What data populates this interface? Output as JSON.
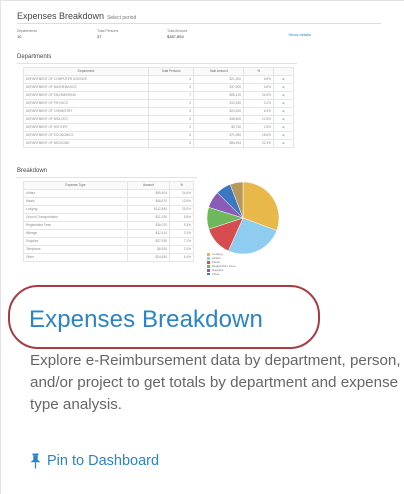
{
  "thumbnail": {
    "title": "Expenses Breakdown",
    "subtitle": "Select period",
    "stats": [
      {
        "label": "Departments",
        "value": "10"
      },
      {
        "label": "Total Persons",
        "value": "37"
      },
      {
        "label": "Total Amount",
        "value": "$387,854"
      }
    ],
    "link": "Show details",
    "departments_section": "Departments",
    "departments_table": {
      "headers": [
        "Department",
        "Total Persons",
        "Total Amount",
        "%",
        ""
      ],
      "rows": [
        [
          "DEPARTMENT OF COMPUTER SCIENCE",
          "4",
          "$21,300",
          "5.5%",
          "⊕"
        ],
        [
          "DEPARTMENT OF MATHEMATICS",
          "3",
          "$17,900",
          "4.6%",
          "⊕"
        ],
        [
          "DEPARTMENT OF ENGINEERING",
          "7",
          "$95,120",
          "24.5%",
          "⊕"
        ],
        [
          "DEPARTMENT OF PHYSICS",
          "2",
          "$12,480",
          "3.2%",
          "⊕"
        ],
        [
          "DEPARTMENT OF CHEMISTRY",
          "3",
          "$24,300",
          "6.3%",
          "⊕"
        ],
        [
          "DEPARTMENT OF BIOLOGY",
          "5",
          "$48,600",
          "12.5%",
          "⊕"
        ],
        [
          "DEPARTMENT OF HISTORY",
          "2",
          "$9,750",
          "2.5%",
          "⊕"
        ],
        [
          "DEPARTMENT OF ECONOMICS",
          "6",
          "$71,950",
          "18.6%",
          "⊕"
        ],
        [
          "DEPARTMENT OF MEDICINE",
          "5",
          "$86,454",
          "22.3%",
          "⊕"
        ]
      ]
    },
    "breakdown_section": "Breakdown",
    "breakdown_table": {
      "headers": [
        "Expense Type",
        "Amount",
        "%"
      ],
      "rows": [
        [
          "Airfare",
          "$95,404",
          "24.6%"
        ],
        [
          "Meals",
          "$48,870",
          "12.6%"
        ],
        [
          "Lodging",
          "$112,480",
          "29.0%"
        ],
        [
          "Ground Transportation",
          "$21,330",
          "5.5%"
        ],
        [
          "Registration Fees",
          "$36,070",
          "9.3%"
        ],
        [
          "Mileage",
          "$12,410",
          "3.2%"
        ],
        [
          "Supplies",
          "$27,930",
          "7.2%"
        ],
        [
          "Telephone",
          "$8,530",
          "2.2%"
        ],
        [
          "Other",
          "$24,830",
          "6.4%"
        ]
      ]
    },
    "pie_colors": [
      "#e9b84a",
      "#8ecdf0",
      "#d64c4f",
      "#6db85a",
      "#8a5bb6",
      "#3b78c2",
      "#b5985a"
    ],
    "legend": [
      "Lodging",
      "Airfare",
      "Meals",
      "Registration Fees",
      "Supplies",
      "Other",
      "Ground Transportation"
    ]
  },
  "card": {
    "title": "Expenses Breakdown",
    "description": "Explore e-Reimbursement data by department, person, and/or project to get totals by department and expense type analysis.",
    "pin_label": "Pin to Dashboard",
    "accent_color": "#2a84c6",
    "highlight_color": "#a93b43"
  }
}
